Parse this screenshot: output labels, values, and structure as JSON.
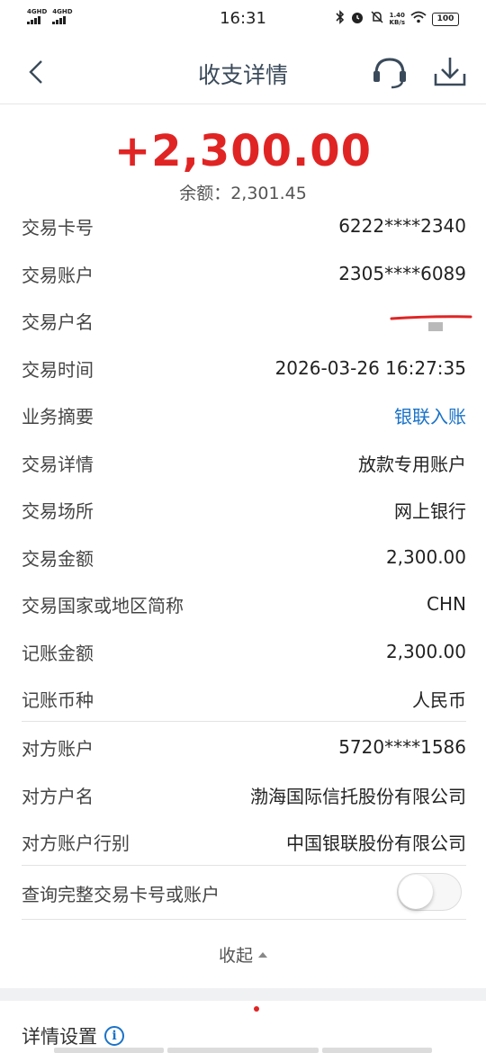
{
  "status_bar": {
    "signal1": "4GHD",
    "signal2": "4GHD",
    "time": "16:31",
    "speed_value": "1.40",
    "speed_unit": "KB/s",
    "battery": "100"
  },
  "nav": {
    "title": "收支详情"
  },
  "summary": {
    "amount": "+2,300.00",
    "amount_color": "#e02424",
    "balance": "余额：2,301.45"
  },
  "details": [
    {
      "label": "交易卡号",
      "value": "6222****2340"
    },
    {
      "label": "交易账户",
      "value": "2305****6089"
    },
    {
      "label": "交易户名",
      "value": ""
    },
    {
      "label": "交易时间",
      "value": "2026-03-26 16:27:35"
    },
    {
      "label": "业务摘要",
      "value": "银联入账"
    },
    {
      "label": "交易详情",
      "value": "放款专用账户"
    },
    {
      "label": "交易场所",
      "value": "网上银行"
    },
    {
      "label": "交易金额",
      "value": "2,300.00"
    },
    {
      "label": "交易国家或地区简称",
      "value": "CHN"
    },
    {
      "label": "记账金额",
      "value": "2,300.00"
    },
    {
      "label": "记账币种",
      "value": "人民币"
    }
  ],
  "counterparty": [
    {
      "label": "对方账户",
      "value": "5720****1586"
    },
    {
      "label": "对方户名",
      "value": "渤海国际信托股份有限公司"
    },
    {
      "label": "对方账户行别",
      "value": "中国银联股份有限公司"
    }
  ],
  "query_toggle": {
    "label": "查询完整交易卡号或账户",
    "enabled": false
  },
  "collapse_label": "收起",
  "settings_label": "详情设置",
  "link_color": "#1a73c8"
}
